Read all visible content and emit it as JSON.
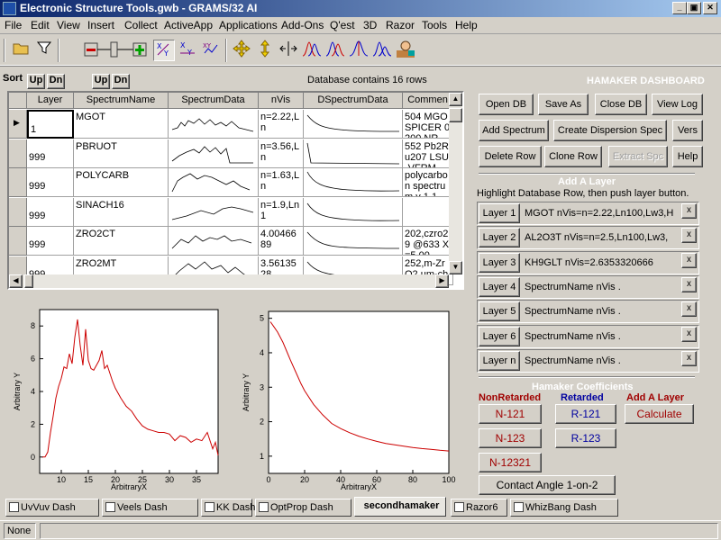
{
  "window": {
    "title": "Electronic Structure Tools.gwb - GRAMS/32 AI",
    "controls": [
      "_",
      "▣",
      "✕"
    ]
  },
  "menu": [
    "File",
    "Edit",
    "View",
    "Insert",
    "Collect",
    "ActiveApp",
    "Applications",
    "Add-Ons",
    "Q'est",
    "3D",
    "Razor",
    "Tools",
    "Help"
  ],
  "toolbar": {
    "icons": [
      "open-folder-icon",
      "select-region-icon",
      "zoom-slider-icon",
      "plus-green-icon",
      "swap-xy-icon",
      "scale-xy-icon",
      "stack-icon",
      "move-cross-icon",
      "move-vertical-icon",
      "split-icon",
      "peaks-icon",
      "peaks-blue-icon",
      "peak-single-icon",
      "peak-pair-icon",
      "user-icon"
    ]
  },
  "sort": {
    "label": "Sort",
    "up": "Up",
    "dn": "Dn",
    "up2": "Up",
    "dn2": "Dn"
  },
  "db_info": "Database contains 16 rows",
  "grid": {
    "columns": [
      "Layer",
      "SpectrumName",
      "SpectrumData",
      "nVis",
      "DSpectrumData",
      "Commen"
    ],
    "rows": [
      {
        "layer": "1",
        "name": "MGOT",
        "nvis": "n=2.22,Ln",
        "comment": "504 MGO SPICER 0 200 NR"
      },
      {
        "layer": "999",
        "name": "PBRUOT",
        "nvis": "n=3.56,Ln",
        "comment": "552 Pb2Ru207 LSU-VFRM"
      },
      {
        "layer": "999",
        "name": "POLYCARB",
        "nvis": "n=1.63,Ln",
        "comment": "polycarbon spectrum v 1.1"
      },
      {
        "layer": "999",
        "name": "SINACH16",
        "nvis": "n=1.9,Ln1",
        "comment": ""
      },
      {
        "layer": "999",
        "name": "ZRO2CT",
        "nvis": "4.0046689",
        "comment": "202,czro29 @633 X=5.00"
      },
      {
        "layer": "999",
        "name": "ZRO2MT",
        "nvis": "3.5613528",
        "comment": "252,m-ZrO2 um-chemKI"
      }
    ]
  },
  "dashboard": {
    "title": "HAMAKER DASHBOARD",
    "buttons_row1": [
      "Open DB",
      "Save As",
      "Close DB",
      "View Log"
    ],
    "buttons_row2": [
      "Add Spectrum",
      "Create Dispersion Spec",
      "Vers"
    ],
    "buttons_row3": [
      "Delete Row",
      "Clone Row",
      "Extract Spc",
      "Help"
    ],
    "add_layer_title": "Add A Layer",
    "add_layer_hint": "Highlight Database Row, then push layer button.",
    "layers": [
      {
        "btn": "Layer 1",
        "text": "MGOT  nVis=n=2.22,Ln100,Lw3,H",
        "x": "x"
      },
      {
        "btn": "Layer 2",
        "text": "AL2O3T  nVis=n=2.5,Ln100,Lw3,",
        "x": "x"
      },
      {
        "btn": "Layer 3",
        "text": "KH9GLT  nVis=2.6353320666",
        "x": "x"
      },
      {
        "btn": "Layer 4",
        "text": "SpectrumName nVis          .",
        "x": "x"
      },
      {
        "btn": "Layer 5",
        "text": "SpectrumName nVis          .",
        "x": "x"
      },
      {
        "btn": "Layer 6",
        "text": "SpectrumName nVis          .",
        "x": "x"
      },
      {
        "btn": "Layer n",
        "text": "SpectrumName nVis          .",
        "x": "x"
      }
    ],
    "coef_title": "Hamaker Coefficients",
    "nonretarded": "NonRetarded",
    "retarded": "Retarded",
    "add_layer_label": "Add A Layer",
    "n121": "N-121",
    "r121": "R-121",
    "calculate": "Calculate",
    "n123": "N-123",
    "r123": "R-123",
    "n12321": "N-12321",
    "contact": "Contact Angle 1-on-2"
  },
  "plots": {
    "left": {
      "ylabel": "Arbitrary Y",
      "xlabel": "ArbitraryX",
      "yticks": [
        "0",
        "2",
        "4",
        "6",
        "8"
      ],
      "xticks": [
        "10",
        "15",
        "20",
        "25",
        "30",
        "35"
      ]
    },
    "right": {
      "ylabel": "Arbitrary Y",
      "xlabel": "ArbitraryX",
      "yticks": [
        "1",
        "2",
        "3",
        "4",
        "5"
      ],
      "xticks": [
        "0",
        "20",
        "40",
        "60",
        "80",
        "100"
      ]
    }
  },
  "chart_data": [
    {
      "type": "line",
      "ylabel": "Arbitrary Y",
      "xlabel": "ArbitraryX",
      "xlim": [
        6,
        39
      ],
      "ylim": [
        -1,
        9
      ],
      "color": "#cc0000",
      "x": [
        6.5,
        7,
        7.5,
        8,
        8.5,
        9,
        9.5,
        10,
        10.5,
        11,
        11.5,
        12,
        12.5,
        13,
        13.5,
        14,
        14.5,
        15,
        15.5,
        16,
        16.5,
        17,
        17.5,
        18,
        18.5,
        19,
        19.5,
        20,
        21,
        22,
        23,
        24,
        25,
        26,
        27,
        28,
        29,
        30,
        31,
        32,
        33,
        34,
        35,
        36,
        37,
        38,
        38.5,
        39
      ],
      "y": [
        0,
        0,
        0.3,
        1.5,
        2.5,
        3.6,
        4.3,
        4.8,
        5.5,
        5.4,
        6.3,
        5.7,
        7.3,
        8.4,
        6.8,
        5.6,
        7.8,
        5.9,
        5.4,
        5.3,
        5.6,
        5.9,
        6.5,
        5.4,
        5.6,
        5.1,
        4.6,
        4.2,
        3.6,
        3.1,
        2.8,
        2.3,
        1.9,
        1.7,
        1.6,
        1.5,
        1.5,
        1.4,
        1.0,
        1.3,
        1.2,
        0.9,
        1.1,
        1.0,
        1.5,
        0.5,
        0.9,
        0.1
      ]
    },
    {
      "type": "line",
      "ylabel": "Arbitrary Y",
      "xlabel": "ArbitraryX",
      "xlim": [
        0,
        100
      ],
      "ylim": [
        0.5,
        5.2
      ],
      "color": "#cc0000",
      "x": [
        1,
        3,
        5,
        8,
        10,
        12,
        15,
        18,
        20,
        25,
        30,
        35,
        40,
        45,
        50,
        55,
        60,
        65,
        70,
        75,
        80,
        85,
        90,
        95,
        100
      ],
      "y": [
        4.9,
        4.75,
        4.6,
        4.3,
        4.05,
        3.8,
        3.45,
        3.1,
        2.9,
        2.5,
        2.2,
        1.95,
        1.8,
        1.68,
        1.58,
        1.5,
        1.43,
        1.37,
        1.33,
        1.29,
        1.25,
        1.22,
        1.2,
        1.17,
        1.15
      ]
    }
  ],
  "tabs": [
    "UvVuv Dash",
    "Veels Dash",
    "KK Dash",
    "OptProp Dash",
    "secondhamaker",
    "Razor6",
    "WhizBang Dash"
  ],
  "statusbar": {
    "text": "None"
  }
}
